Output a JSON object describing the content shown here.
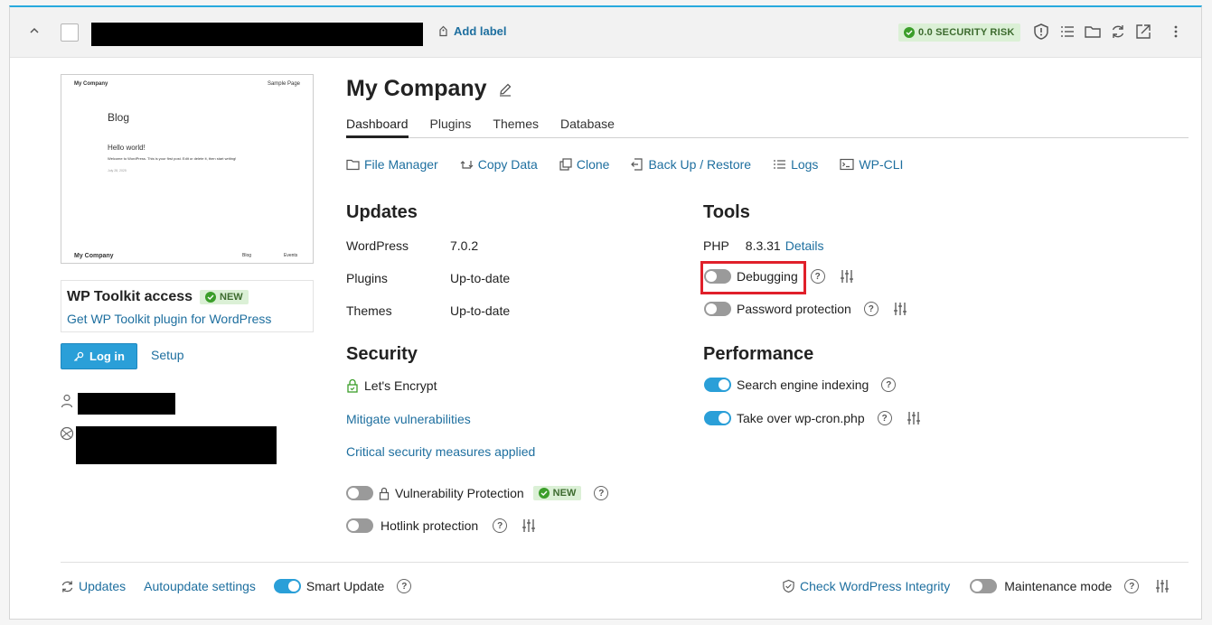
{
  "header": {
    "add_label": "Add label",
    "security_badge": "0.0 SECURITY RISK"
  },
  "preview": {
    "site_name_top": "My Company",
    "sample_page": "Sample Page",
    "blog": "Blog",
    "hello": "Hello world!",
    "welcome": "Welcome to WordPress. This is your first post. Edit or delete it, then start writing!",
    "date": "July 28, 2025",
    "footer_name": "My Company",
    "footer_blog": "Blog",
    "footer_events": "Events"
  },
  "access": {
    "title": "WP Toolkit access",
    "new_badge": "NEW",
    "link": "Get WP Toolkit plugin for WordPress",
    "login": "Log in",
    "setup": "Setup"
  },
  "site": {
    "title": "My Company"
  },
  "tabs": [
    "Dashboard",
    "Plugins",
    "Themes",
    "Database"
  ],
  "actions": [
    "File Manager",
    "Copy Data",
    "Clone",
    "Back Up / Restore",
    "Logs",
    "WP-CLI"
  ],
  "updates": {
    "title": "Updates",
    "rows": [
      {
        "label": "WordPress",
        "value": "7.0.2"
      },
      {
        "label": "Plugins",
        "value": "Up-to-date"
      },
      {
        "label": "Themes",
        "value": "Up-to-date"
      }
    ]
  },
  "security": {
    "title": "Security",
    "encrypt": "Let's Encrypt",
    "mitigate": "Mitigate vulnerabilities",
    "critical": "Critical security measures applied",
    "vuln": "Vulnerability Protection",
    "vuln_badge": "NEW",
    "hotlink": "Hotlink protection"
  },
  "tools": {
    "title": "Tools",
    "php_label": "PHP",
    "php_version": "8.3.31",
    "details": "Details",
    "debugging": "Debugging",
    "password": "Password protection"
  },
  "performance": {
    "title": "Performance",
    "indexing": "Search engine indexing",
    "cron": "Take over wp-cron.php"
  },
  "footer": {
    "updates": "Updates",
    "autoupdate": "Autoupdate settings",
    "smart_update": "Smart Update",
    "integrity": "Check WordPress Integrity",
    "maintenance": "Maintenance mode"
  },
  "colors": {
    "accent": "#2a9fd8",
    "link": "#1e6f9f",
    "highlight": "#e0202a",
    "ok_green": "#3b9e2a"
  }
}
